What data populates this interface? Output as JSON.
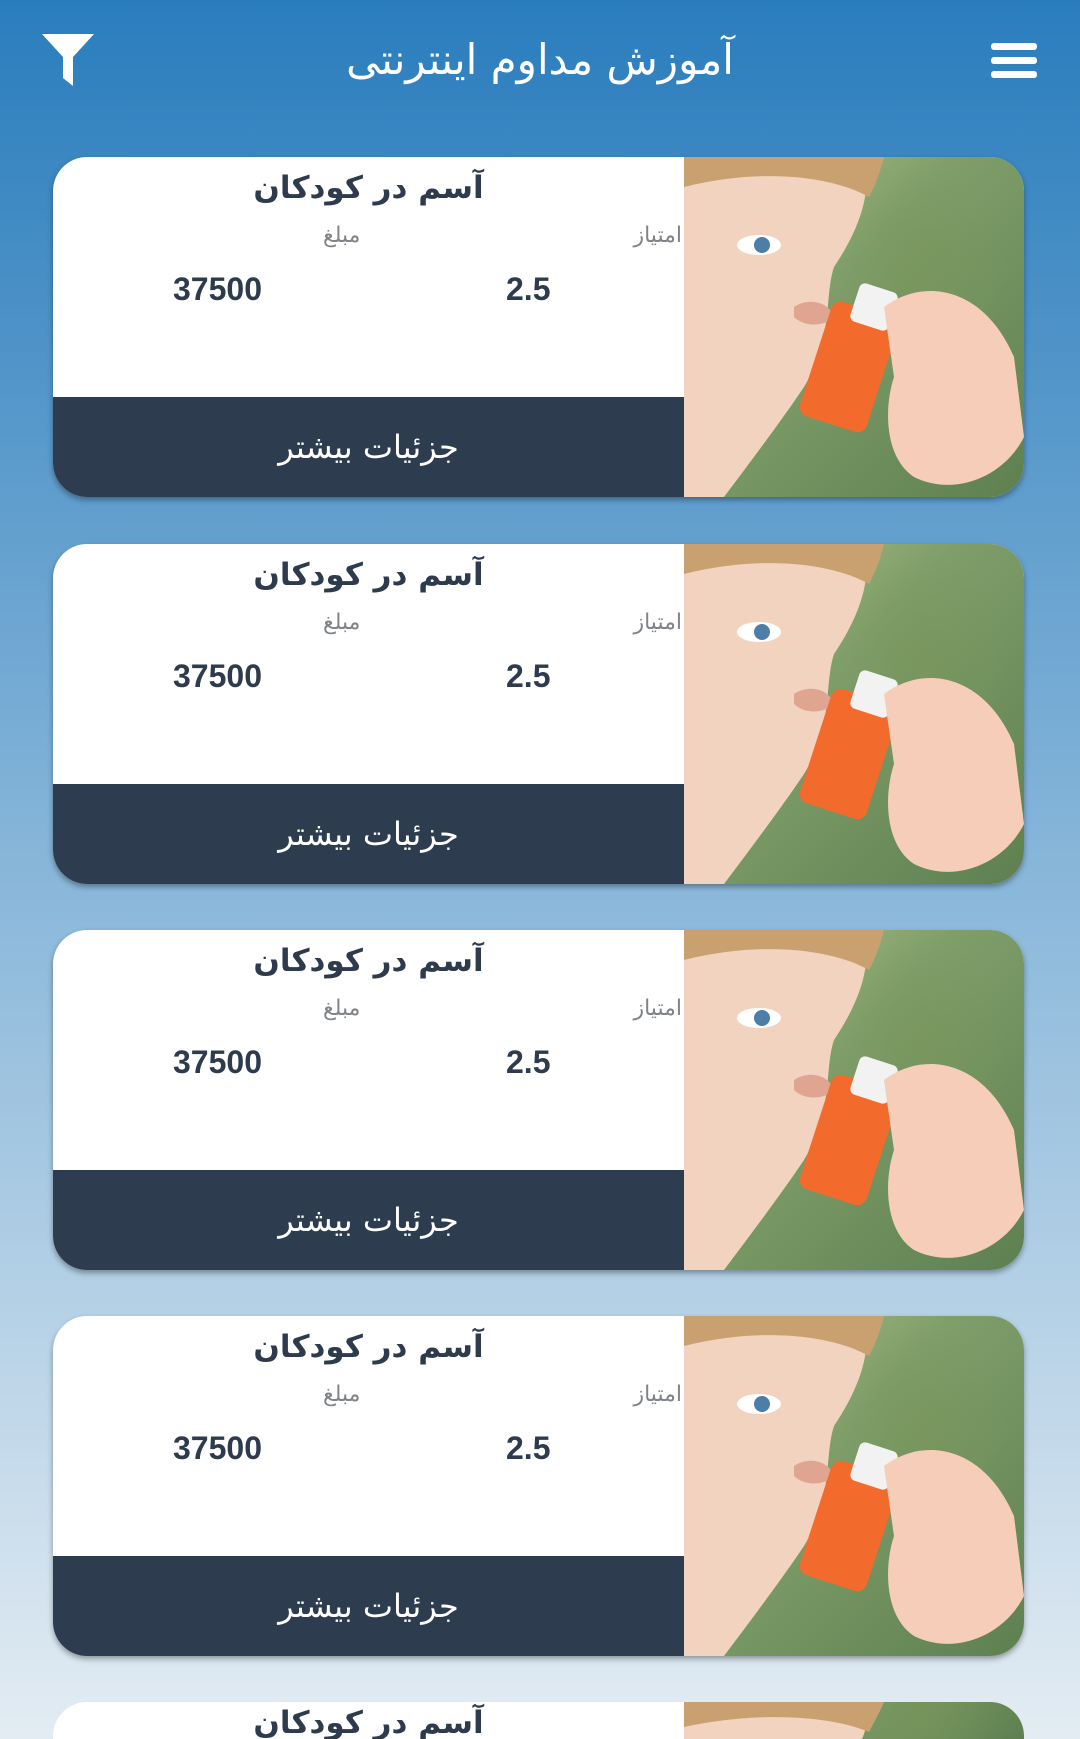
{
  "header": {
    "title": "آموزش مداوم اینترنتی",
    "filter_icon": "filter-funnel",
    "menu_icon": "hamburger-menu"
  },
  "courses": [
    {
      "title": "آسم در کودکان",
      "score_label": "امتیاز",
      "score": "2.5",
      "price_label": "مبلغ",
      "price": "37500",
      "button_label": "جزئیات بیشتر"
    },
    {
      "title": "آسم در کودکان",
      "score_label": "امتیاز",
      "score": "2.5",
      "price_label": "مبلغ",
      "price": "37500",
      "button_label": "جزئیات بیشتر"
    },
    {
      "title": "آسم در کودکان",
      "score_label": "امتیاز",
      "score": "2.5",
      "price_label": "مبلغ",
      "price": "37500",
      "button_label": "جزئیات بیشتر"
    },
    {
      "title": "آسم در کودکان",
      "score_label": "امتیاز",
      "score": "2.5",
      "price_label": "مبلغ",
      "price": "37500",
      "button_label": "جزئیات بیشتر"
    },
    {
      "title": "آسم در کودکان"
    }
  ],
  "colors": {
    "header_blue": "#2a7dbd",
    "button_dark": "#2e3c50",
    "text_dark": "#2d3b4d",
    "label_gray": "#808488"
  }
}
